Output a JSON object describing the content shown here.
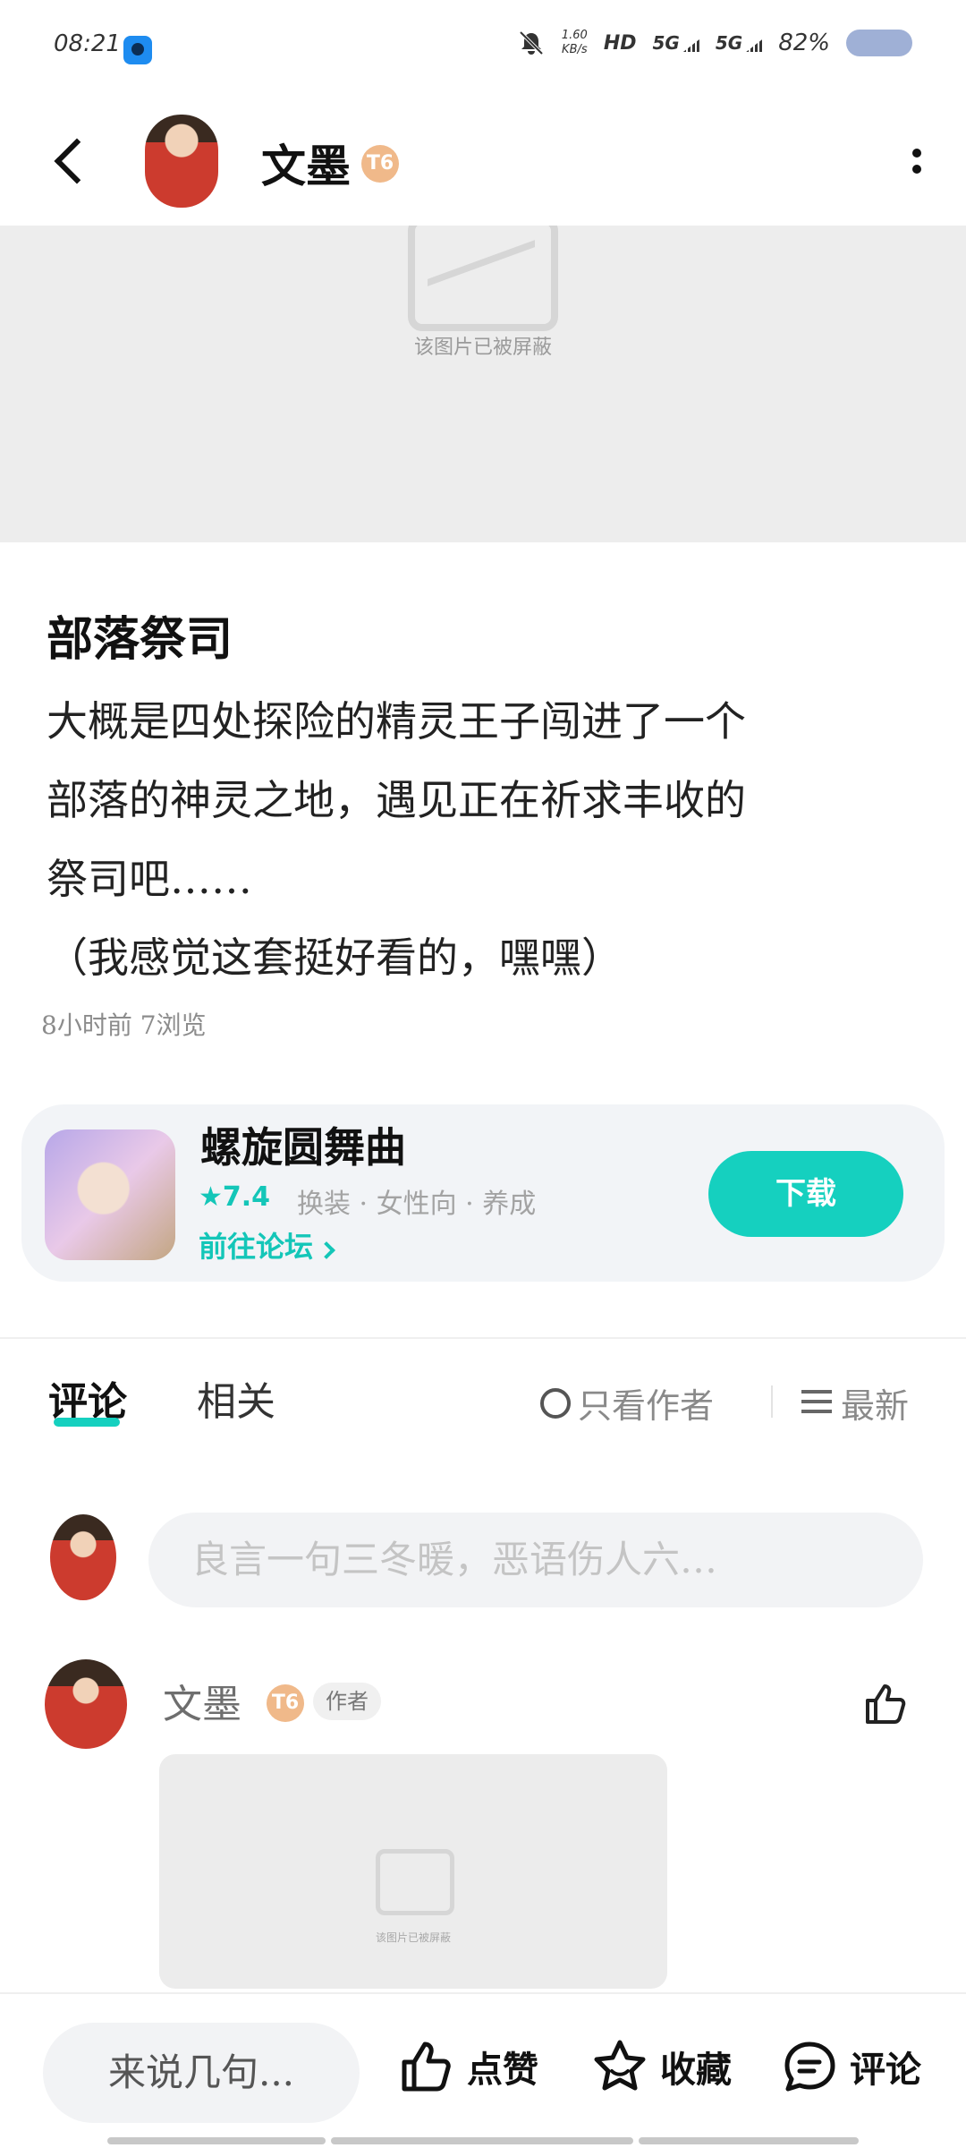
{
  "status_bar": {
    "time": "08:21",
    "net_speed_value": "1.60",
    "net_speed_unit": "KB/s",
    "hd": "HD",
    "signal1": "5G",
    "signal2": "5G",
    "battery": "82%"
  },
  "header": {
    "author_name": "文墨",
    "level_badge": "T6"
  },
  "post_image": {
    "blocked_text": "该图片已被屏蔽"
  },
  "post": {
    "title": "部落祭司",
    "body_lines": [
      "大概是四处探险的精灵王子闯进了一个",
      "部落的神灵之地，遇见正在祈求丰收的",
      "祭司吧……",
      "（我感觉这套挺好看的，嘿嘿）"
    ],
    "meta": "8小时前  7浏览"
  },
  "app_card": {
    "name": "螺旋圆舞曲",
    "rating": "★7.4",
    "tags": "换装 · 女性向 · 养成",
    "forum_link": "前往论坛",
    "download": "下载"
  },
  "tabs": {
    "comments": "评论",
    "related": "相关",
    "author_only": "只看作者",
    "sort": "最新"
  },
  "comment_input": {
    "placeholder": "良言一句三冬暖，恶语伤人六…"
  },
  "comment": {
    "name": "文墨",
    "level_badge": "T6",
    "author_tag": "作者",
    "image_blocked_text": "该图片已被屏蔽"
  },
  "bottom_bar": {
    "input_placeholder": "来说几句...",
    "like": "点赞",
    "favorite": "收藏",
    "comment": "评论"
  },
  "colors": {
    "accent": "#15d0bf",
    "background": "#ffffff",
    "card": "#f2f4f7"
  },
  "icons": [
    "back-icon",
    "more-icon",
    "bell-off-icon",
    "like-icon",
    "star-icon",
    "comment-icon",
    "sort-icon",
    "chevron-right-icon",
    "image-placeholder-icon"
  ]
}
